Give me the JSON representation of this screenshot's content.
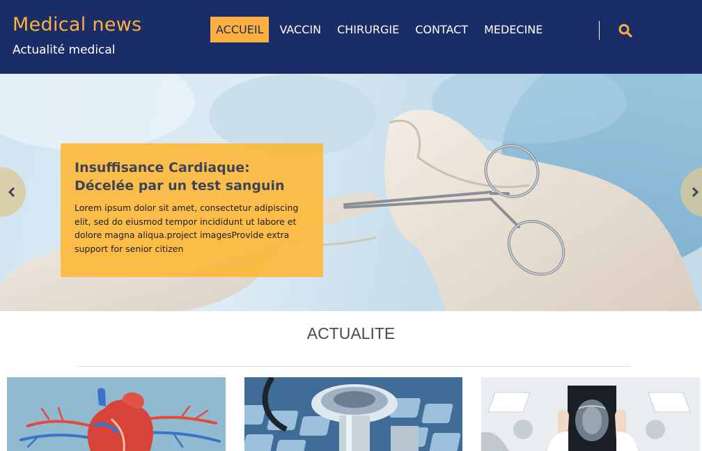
{
  "brand": {
    "title": "Medical news",
    "subtitle": "Actualité medical"
  },
  "nav": {
    "items": [
      "ACCUEIL",
      "VACCIN",
      "CHIRURGIE",
      "CONTACT",
      "MEDECINE"
    ],
    "active": "ACCUEIL"
  },
  "colors": {
    "header": "#1b2d66",
    "accent": "#fbb040",
    "caption_bg": "#fdb83c"
  },
  "icons": {
    "search": "search-icon",
    "prev": "chevron-left-icon",
    "next": "chevron-right-icon"
  },
  "hero": {
    "title": "Insuffisance Cardiaque: Décelée par un test sanguin",
    "text": "Lorem ipsum dolor sit amet, consectetur adipiscing elit, sed do eiusmod tempor incididunt ut labore et dolore magna aliqua.project imagesProvide extra support for senior citizen"
  },
  "section": {
    "title": "ACTUALITE"
  },
  "cards": [
    {
      "image": "heart-illustration"
    },
    {
      "image": "stethoscope-keyboard"
    },
    {
      "image": "doctor-brain-scan"
    }
  ]
}
